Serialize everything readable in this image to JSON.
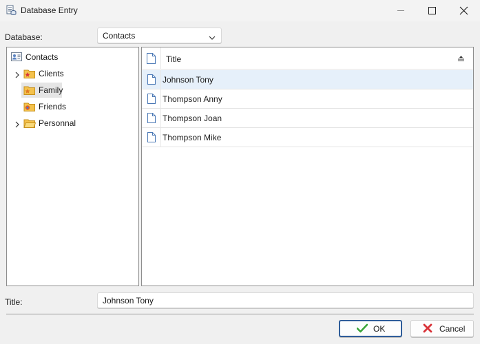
{
  "window": {
    "title": "Database Entry",
    "icon": "database-entry-icon",
    "controls": [
      "minimize-icon",
      "maximize-icon",
      "close-icon"
    ]
  },
  "database": {
    "label": "Database:",
    "selected": "Contacts",
    "dropdown_icon": "chevron-down-icon"
  },
  "tree": {
    "root": {
      "label": "Contacts",
      "icon": "contact-card-icon"
    },
    "items": [
      {
        "label": "Clients",
        "icon": "star-folder-icon",
        "expandable": true,
        "selected": false
      },
      {
        "label": "Family",
        "icon": "star-folder-icon",
        "expandable": false,
        "selected": true
      },
      {
        "label": "Friends",
        "icon": "star-folder-icon",
        "expandable": false,
        "selected": false
      },
      {
        "label": "Personnal",
        "icon": "folder-icon",
        "expandable": true,
        "selected": false
      }
    ]
  },
  "list": {
    "header": {
      "title": "Title",
      "sort_icon": "sort-icon"
    },
    "rows": [
      {
        "title": "Johnson Tony",
        "selected": true
      },
      {
        "title": "Thompson Anny",
        "selected": false
      },
      {
        "title": "Thompson Joan",
        "selected": false
      },
      {
        "title": "Thompson Mike",
        "selected": false
      }
    ]
  },
  "title_field": {
    "label": "Title:",
    "value": "Johnson Tony"
  },
  "buttons": {
    "ok": "OK",
    "cancel": "Cancel"
  },
  "colors": {
    "selection": "#e6f0fa",
    "accent_border": "#2f5d9a",
    "ok_check": "#3aa63a",
    "cancel_x": "#d9343a",
    "folder": "#f4c24d"
  }
}
